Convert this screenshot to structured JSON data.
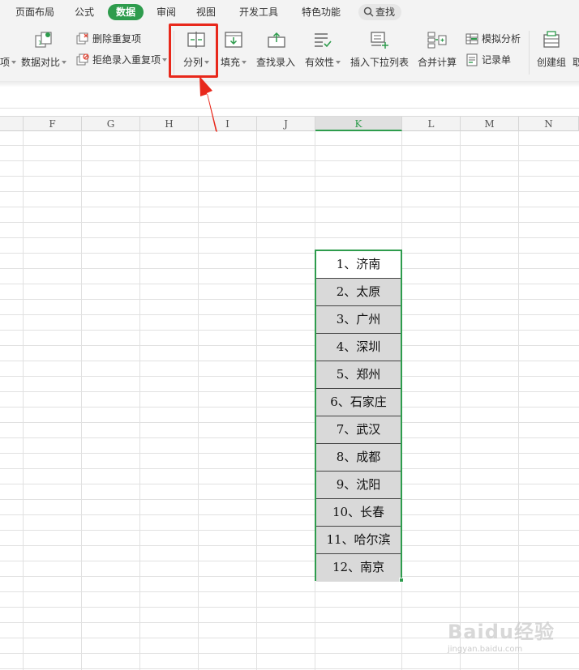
{
  "tabs": {
    "page_layout": "页面布局",
    "formula": "公式",
    "data": "数据",
    "review": "审阅",
    "view": "视图",
    "developer": "开发工具",
    "special": "特色功能",
    "search": "查找"
  },
  "ribbon": {
    "cut_edge_left": "项",
    "data_compare": "数据对比",
    "delete_duplicates": "删除重复项",
    "reject_duplicates": "拒绝录入重复项",
    "split_column": "分列",
    "fill": "填充",
    "lookup_entry": "查找录入",
    "validity": "有效性",
    "insert_dropdown": "插入下拉列表",
    "consolidate": "合并计算",
    "simulation": "模拟分析",
    "record_form": "记录单",
    "create_group": "创建组",
    "cut_edge_right": "取"
  },
  "columns": [
    "F",
    "G",
    "H",
    "I",
    "J",
    "K",
    "L",
    "M",
    "N"
  ],
  "selected_column": "K",
  "cells": [
    "1、济南",
    "2、太原",
    "3、广州",
    "4、深圳",
    "5、郑州",
    "6、石家庄",
    "7、武汉",
    "8、成都",
    "9、沈阳",
    "10、长春",
    "11、哈尔滨",
    "12、南京"
  ],
  "watermark": {
    "logo": "Baidu经验",
    "url": "jingyan.baidu.com"
  },
  "colors": {
    "accent_green": "#2e9c4d",
    "highlight_red": "#e8281b",
    "cell_gray": "#d9d9d9"
  }
}
